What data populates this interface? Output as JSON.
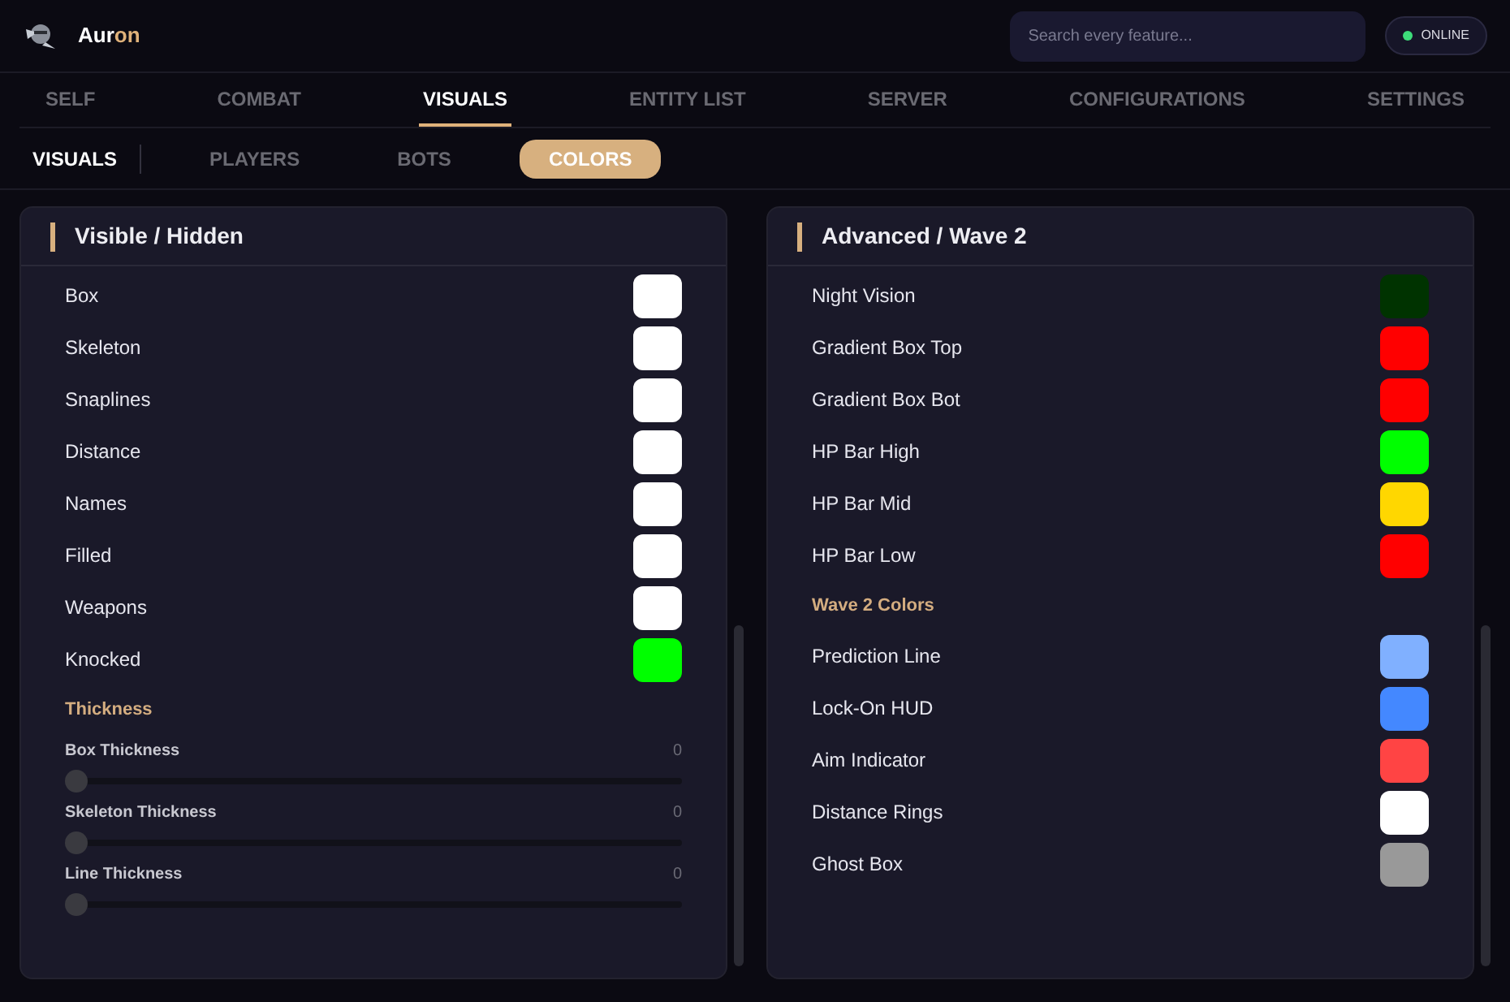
{
  "app": {
    "name_start": "Aur",
    "name_accent": "on"
  },
  "search": {
    "placeholder": "Search every feature..."
  },
  "status": {
    "label": "ONLINE",
    "on": true
  },
  "tabs": [
    {
      "label": "SELF",
      "selected": false
    },
    {
      "label": "COMBAT",
      "selected": false
    },
    {
      "label": "VISUALS",
      "selected": true
    },
    {
      "label": "ENTITY LIST",
      "selected": false
    },
    {
      "label": "SERVER",
      "selected": false
    },
    {
      "label": "CONFIGURATIONS",
      "selected": false
    },
    {
      "label": "SETTINGS",
      "selected": false
    }
  ],
  "subnav": {
    "title": "VISUALS",
    "tabs": [
      {
        "label": "PLAYERS",
        "selected": false
      },
      {
        "label": "BOTS",
        "selected": false
      },
      {
        "label": "COLORS",
        "selected": true
      }
    ]
  },
  "panels": [
    {
      "title": "Visible / Hidden",
      "items": [
        {
          "kind": "color",
          "label": "Box",
          "color": "#ffffff"
        },
        {
          "kind": "color",
          "label": "Skeleton",
          "color": "#ffffff"
        },
        {
          "kind": "color",
          "label": "Snaplines",
          "color": "#ffffff"
        },
        {
          "kind": "color",
          "label": "Distance",
          "color": "#ffffff"
        },
        {
          "kind": "color",
          "label": "Names",
          "color": "#ffffff"
        },
        {
          "kind": "color",
          "label": "Filled",
          "color": "#ffffff"
        },
        {
          "kind": "color",
          "label": "Weapons",
          "color": "#ffffff"
        },
        {
          "kind": "color",
          "label": "Knocked",
          "color": "#00ff00"
        },
        {
          "kind": "section",
          "label": "Thickness"
        },
        {
          "kind": "slider",
          "label": "Box Thickness",
          "reading": "0",
          "level": 0
        },
        {
          "kind": "slider",
          "label": "Skeleton Thickness",
          "reading": "0",
          "level": 0
        },
        {
          "kind": "slider",
          "label": "Line Thickness",
          "reading": "0",
          "level": 0
        }
      ]
    },
    {
      "title": "Advanced / Wave 2",
      "items": [
        {
          "kind": "color",
          "label": "Night Vision",
          "color": "#003300"
        },
        {
          "kind": "color",
          "label": "Gradient Box Top",
          "color": "#ff0000"
        },
        {
          "kind": "color",
          "label": "Gradient Box Bot",
          "color": "#ff0000"
        },
        {
          "kind": "color",
          "label": "HP Bar High",
          "color": "#00ff00"
        },
        {
          "kind": "color",
          "label": "HP Bar Mid",
          "color": "#ffd700"
        },
        {
          "kind": "color",
          "label": "HP Bar Low",
          "color": "#ff0000"
        },
        {
          "kind": "section",
          "label": "Wave 2 Colors"
        },
        {
          "kind": "color",
          "label": "Prediction Line",
          "color": "#80b0ff"
        },
        {
          "kind": "color",
          "label": "Lock-On HUD",
          "color": "#4488ff"
        },
        {
          "kind": "color",
          "label": "Aim Indicator",
          "color": "#ff4444"
        },
        {
          "kind": "color",
          "label": "Distance Rings",
          "color": "#ffffff"
        },
        {
          "kind": "color",
          "label": "Ghost Box",
          "color": "#999999"
        }
      ]
    }
  ]
}
